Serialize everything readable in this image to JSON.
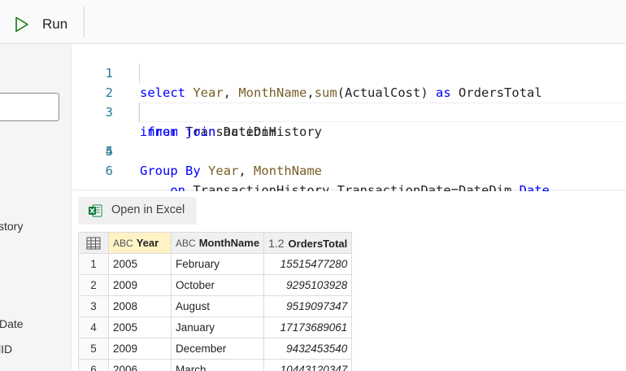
{
  "toolbar": {
    "run_label": "Run"
  },
  "left_pane": {
    "text_1": "story",
    "text_2": "Date",
    "text_3": "lID"
  },
  "editor": {
    "lines": [
      {
        "num": "1"
      },
      {
        "num": "2"
      },
      {
        "num": "3"
      },
      {
        "num": "4"
      },
      {
        "num": "5"
      },
      {
        "num": "6"
      }
    ],
    "tokens": {
      "select": "select",
      "year": "Year",
      "monthname": "MonthName",
      "sum": "sum",
      "actualcost": "ActualCost",
      "as": "as",
      "orderstotal": "OrdersTotal",
      "from": "from",
      "transactionhistory": "TransactionHistory",
      "inner": "inner",
      "join": "join",
      "datedim": "DateDim",
      "on": "on",
      "transactiondate": "TransactionDate",
      "date": "Date",
      "group": "Group",
      "by": "By"
    }
  },
  "results": {
    "open_excel_label": "Open in Excel",
    "columns": [
      {
        "type": "ABC",
        "name": "Year"
      },
      {
        "type": "ABC",
        "name": "MonthName"
      },
      {
        "type": "1.2",
        "name": "OrdersTotal"
      }
    ],
    "rows": [
      {
        "n": "1",
        "year": "2005",
        "month": "February",
        "total": "15515477280"
      },
      {
        "n": "2",
        "year": "2009",
        "month": "October",
        "total": "9295103928"
      },
      {
        "n": "3",
        "year": "2008",
        "month": "August",
        "total": "9519097347"
      },
      {
        "n": "4",
        "year": "2005",
        "month": "January",
        "total": "17173689061"
      },
      {
        "n": "5",
        "year": "2009",
        "month": "December",
        "total": "9432453540"
      },
      {
        "n": "6",
        "year": "2006",
        "month": "March",
        "total": "10443120347"
      }
    ]
  },
  "colors": {
    "keyword": "#0000ff",
    "function": "#795e26",
    "line_number": "#237893",
    "run_icon": "#107c10",
    "excel_green": "#107c41",
    "selected_header": "#fff2c4"
  }
}
